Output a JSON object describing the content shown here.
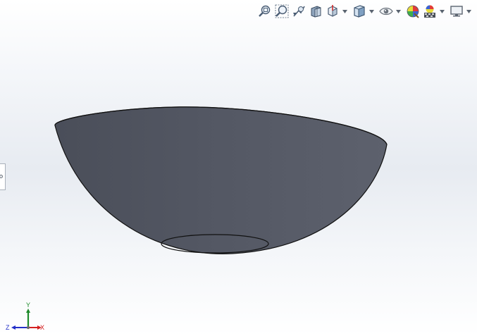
{
  "toolbar": {
    "items": [
      {
        "name": "zoom-to-fit",
        "icon": "magnifier-fit-icon"
      },
      {
        "name": "zoom-to-area",
        "icon": "magnifier-area-icon"
      },
      {
        "name": "previous-view",
        "icon": "previous-view-icon"
      },
      {
        "name": "section-view",
        "icon": "section-view-icon"
      },
      {
        "name": "view-orientation",
        "icon": "view-orientation-icon",
        "dropdown": true
      },
      {
        "name": "display-style",
        "icon": "display-style-cube-icon",
        "dropdown": true
      },
      {
        "name": "hide-show-items",
        "icon": "eye-icon",
        "dropdown": true
      },
      {
        "name": "edit-appearance",
        "icon": "appearance-sphere-icon"
      },
      {
        "name": "apply-scene",
        "icon": "scene-icon",
        "dropdown": true
      },
      {
        "name": "view-settings",
        "icon": "monitor-icon",
        "dropdown": true
      }
    ]
  },
  "model": {
    "shape": "hemispherical-bowl",
    "face_color": "#545864"
  },
  "triad": {
    "x_label": "X",
    "y_label": "Y",
    "z_label": "Z",
    "x_color": "#d42020",
    "y_color": "#1f8a2b",
    "z_color": "#2330c8"
  }
}
